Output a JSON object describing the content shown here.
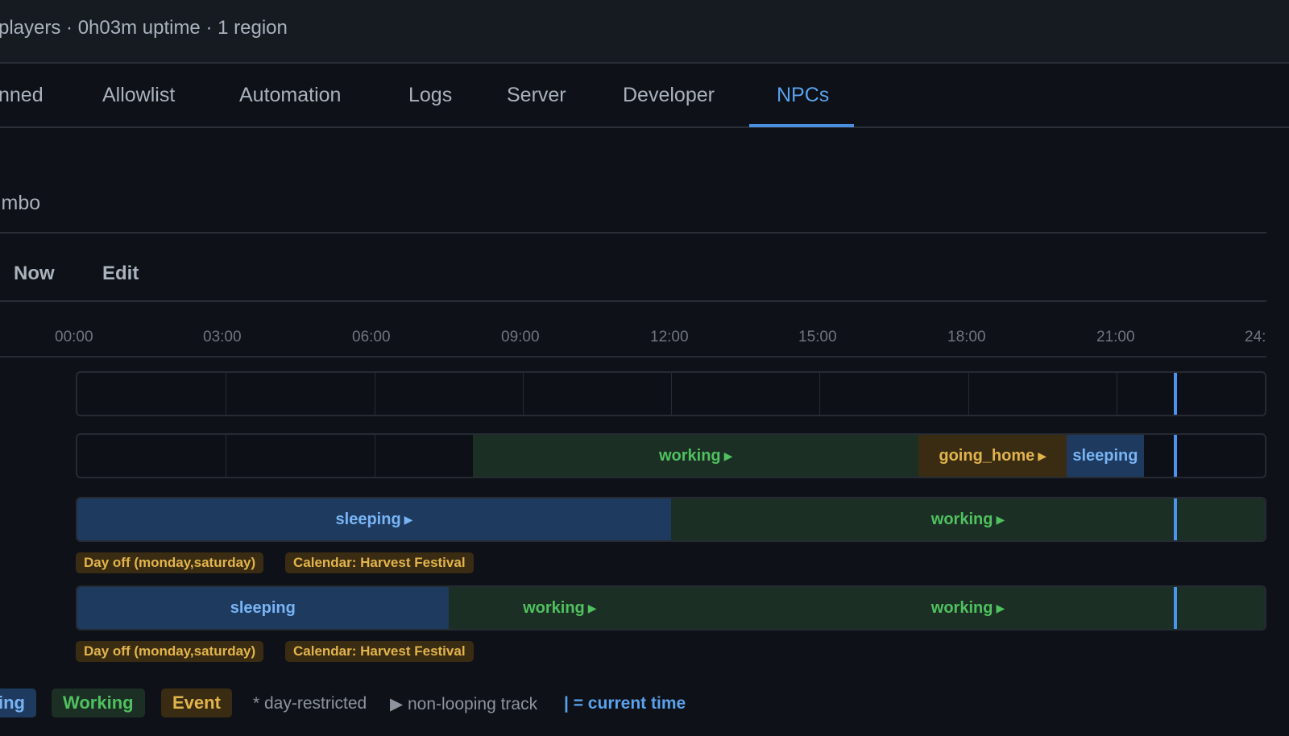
{
  "header": {
    "status_text": "players · 0h03m uptime · 1 region"
  },
  "tabs": [
    {
      "label": "nned"
    },
    {
      "label": "Allowlist"
    },
    {
      "label": "Automation"
    },
    {
      "label": "Logs"
    },
    {
      "label": "Server"
    },
    {
      "label": "Developer"
    },
    {
      "label": "NPCs",
      "active": true
    }
  ],
  "npc": {
    "name": "imbo"
  },
  "subtabs": [
    {
      "label": "Now"
    },
    {
      "label": "Edit"
    }
  ],
  "timeline": {
    "hour_labels": [
      "00:00",
      "03:00",
      "06:00",
      "09:00",
      "12:00",
      "15:00",
      "18:00",
      "21:00",
      "24:"
    ],
    "current_time_hours": 22.2,
    "tracks": [
      {
        "segments": []
      },
      {
        "segments": [
          {
            "state": "working",
            "label": "working",
            "arrow": "▶",
            "start": 8.0,
            "end": 17.0
          },
          {
            "state": "event",
            "label": "going_home",
            "arrow": "▶",
            "start": 17.0,
            "end": 20.0
          },
          {
            "state": "sleeping",
            "label": "sleeping",
            "arrow": "",
            "start": 20.0,
            "end": 21.55
          }
        ]
      },
      {
        "segments": [
          {
            "state": "sleeping",
            "label": "sleeping",
            "arrow": "▶",
            "start": 0.0,
            "end": 12.0
          },
          {
            "state": "working",
            "label": "working",
            "arrow": "▶",
            "start": 12.0,
            "end": 24.0
          }
        ],
        "badges": [
          "Day off (monday,saturday)",
          "Calendar: Harvest Festival"
        ]
      },
      {
        "segments": [
          {
            "state": "sleeping",
            "label": "sleeping",
            "arrow": "",
            "start": 0.0,
            "end": 7.5
          },
          {
            "state": "working",
            "label": "working",
            "arrow": "▶",
            "start": 7.5,
            "end": 12.0
          },
          {
            "state": "working",
            "label": "working",
            "arrow": "▶",
            "start": 12.0,
            "end": 24.0
          }
        ],
        "badges": [
          "Day off (monday,saturday)",
          "Calendar: Harvest Festival"
        ]
      }
    ]
  },
  "legend": {
    "sleeping": "ing",
    "working": "Working",
    "event": "Event",
    "day_restricted": "* day-restricted",
    "non_looping": "▶ non-looping track",
    "current_time": "| = current time"
  },
  "colors": {
    "accent": "#4a93f0",
    "sleeping_bg": "#1e3a5f",
    "working_bg": "#1c2f25",
    "event_bg": "#3a2c12"
  }
}
